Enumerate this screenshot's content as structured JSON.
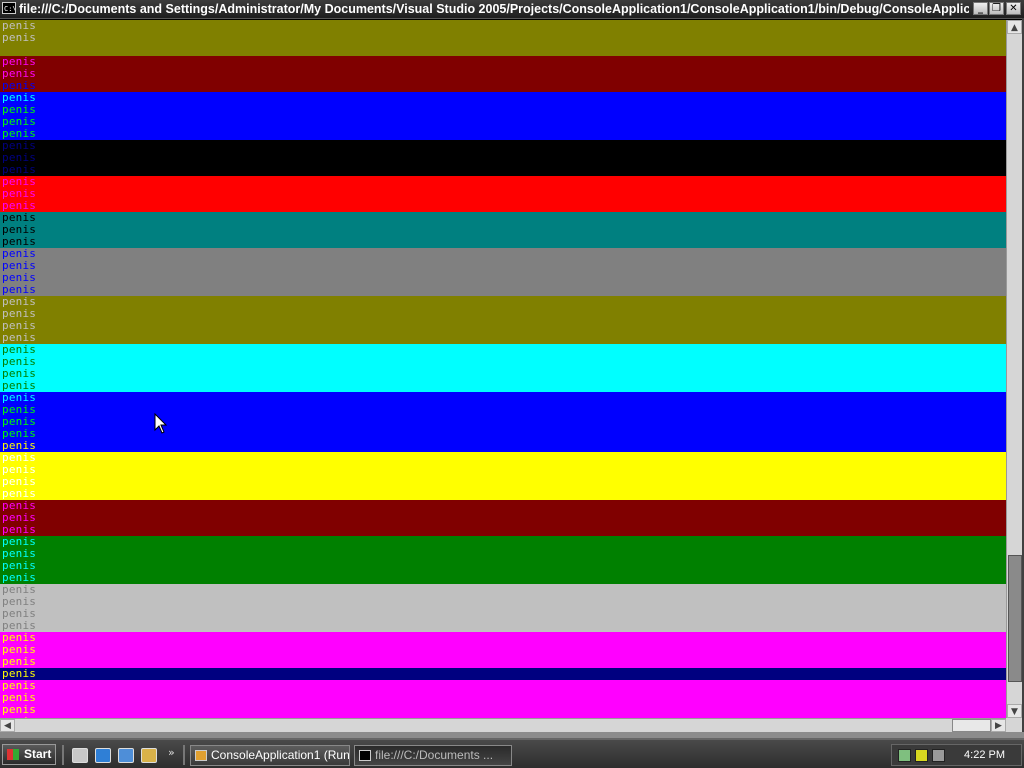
{
  "window": {
    "icon_text": "C:\\",
    "title": "file:///C:/Documents and Settings/Administrator/My Documents/Visual Studio 2005/Projects/ConsoleApplication1/ConsoleApplication1/bin/Debug/ConsoleApplicatio...",
    "minimize": "_",
    "restore": "❐",
    "close": "✕"
  },
  "console": {
    "word": "penis",
    "lines": [
      {
        "bg": "#808000",
        "fg": "#c0c0c0",
        "text": "penis"
      },
      {
        "bg": "#808000",
        "fg": "#c0c0c0",
        "text": "penis"
      },
      {
        "bg": "#808000",
        "fg": "#c0c0c0",
        "text": ""
      },
      {
        "bg": "#800000",
        "fg": "#ff00ff",
        "text": "penis"
      },
      {
        "bg": "#800000",
        "fg": "#ff00ff",
        "text": "penis"
      },
      {
        "bg": "#800000",
        "fg": "#0000ff",
        "text": "penis"
      },
      {
        "bg": "#0000ff",
        "fg": "#00ffff",
        "text": "penis"
      },
      {
        "bg": "#0000ff",
        "fg": "#00ff00",
        "text": "penis"
      },
      {
        "bg": "#0000ff",
        "fg": "#00ff00",
        "text": "penis"
      },
      {
        "bg": "#0000ff",
        "fg": "#00ff00",
        "text": "penis"
      },
      {
        "bg": "#000000",
        "fg": "#000080",
        "text": "penis"
      },
      {
        "bg": "#000000",
        "fg": "#000080",
        "text": "penis"
      },
      {
        "bg": "#000000",
        "fg": "#000080",
        "text": "penis"
      },
      {
        "bg": "#ff0000",
        "fg": "#ff00ff",
        "text": "penis"
      },
      {
        "bg": "#ff0000",
        "fg": "#ff00ff",
        "text": "penis"
      },
      {
        "bg": "#ff0000",
        "fg": "#ff00ff",
        "text": "penis"
      },
      {
        "bg": "#008080",
        "fg": "#000000",
        "text": "penis"
      },
      {
        "bg": "#008080",
        "fg": "#000000",
        "text": "penis"
      },
      {
        "bg": "#008080",
        "fg": "#000000",
        "text": "penis"
      },
      {
        "bg": "#808080",
        "fg": "#0000ff",
        "text": "penis"
      },
      {
        "bg": "#808080",
        "fg": "#0000ff",
        "text": "penis"
      },
      {
        "bg": "#808080",
        "fg": "#0000ff",
        "text": "penis"
      },
      {
        "bg": "#808080",
        "fg": "#0000ff",
        "text": "penis"
      },
      {
        "bg": "#808000",
        "fg": "#c0c0c0",
        "text": "penis"
      },
      {
        "bg": "#808000",
        "fg": "#c0c0c0",
        "text": "penis"
      },
      {
        "bg": "#808000",
        "fg": "#c0c0c0",
        "text": "penis"
      },
      {
        "bg": "#808000",
        "fg": "#c0c0c0",
        "text": "penis"
      },
      {
        "bg": "#00ffff",
        "fg": "#008000",
        "text": "penis"
      },
      {
        "bg": "#00ffff",
        "fg": "#008000",
        "text": "penis"
      },
      {
        "bg": "#00ffff",
        "fg": "#008000",
        "text": "penis"
      },
      {
        "bg": "#00ffff",
        "fg": "#008000",
        "text": "penis"
      },
      {
        "bg": "#0000ff",
        "fg": "#00ffff",
        "text": "penis"
      },
      {
        "bg": "#0000ff",
        "fg": "#00ff00",
        "text": "penis"
      },
      {
        "bg": "#0000ff",
        "fg": "#00ff00",
        "text": "penis"
      },
      {
        "bg": "#0000ff",
        "fg": "#00ff00",
        "text": "penis"
      },
      {
        "bg": "#0000ff",
        "fg": "#ffff00",
        "text": "penis"
      },
      {
        "bg": "#ffff00",
        "fg": "#ffffff",
        "text": "penis"
      },
      {
        "bg": "#ffff00",
        "fg": "#ffffff",
        "text": "penis"
      },
      {
        "bg": "#ffff00",
        "fg": "#ffffff",
        "text": "penis"
      },
      {
        "bg": "#ffff00",
        "fg": "#ffffff",
        "text": "penis"
      },
      {
        "bg": "#800000",
        "fg": "#ff00ff",
        "text": "penis"
      },
      {
        "bg": "#800000",
        "fg": "#ff00ff",
        "text": "penis"
      },
      {
        "bg": "#800000",
        "fg": "#ff00ff",
        "text": "penis"
      },
      {
        "bg": "#008000",
        "fg": "#00ffff",
        "text": "penis"
      },
      {
        "bg": "#008000",
        "fg": "#00ffff",
        "text": "penis"
      },
      {
        "bg": "#008000",
        "fg": "#00ffff",
        "text": "penis"
      },
      {
        "bg": "#008000",
        "fg": "#00ffff",
        "text": "penis"
      },
      {
        "bg": "#c0c0c0",
        "fg": "#808080",
        "text": "penis"
      },
      {
        "bg": "#c0c0c0",
        "fg": "#808080",
        "text": "penis"
      },
      {
        "bg": "#c0c0c0",
        "fg": "#808080",
        "text": "penis"
      },
      {
        "bg": "#c0c0c0",
        "fg": "#808080",
        "text": "penis"
      },
      {
        "bg": "#ff00ff",
        "fg": "#ffff00",
        "text": "penis"
      },
      {
        "bg": "#ff00ff",
        "fg": "#ffff00",
        "text": "penis"
      },
      {
        "bg": "#ff00ff",
        "fg": "#ffff00",
        "text": "penis"
      },
      {
        "bg": "#000080",
        "fg": "#ffff00",
        "text": "penis"
      },
      {
        "bg": "#ff00ff",
        "fg": "#ffff00",
        "text": "penis"
      },
      {
        "bg": "#ff00ff",
        "fg": "#ffff00",
        "text": "penis"
      },
      {
        "bg": "#ff00ff",
        "fg": "#ffff00",
        "text": "penis"
      },
      {
        "bg": "#ff00ff",
        "fg": "#ffff00",
        "text": "penis"
      }
    ]
  },
  "scrollbars": {
    "vertical_position": 0.96,
    "vertical_visible_fraction": 0.19,
    "horizontal_position": 1.0,
    "horizontal_visible_fraction": 0.04
  },
  "taskbar": {
    "start_label": "Start",
    "quick_launch": [
      {
        "name": "show-desktop-icon",
        "color": "#c8c8c8"
      },
      {
        "name": "internet-explorer-icon",
        "color": "#2f7fd6"
      },
      {
        "name": "outlook-express-icon",
        "color": "#4e8ed8"
      },
      {
        "name": "windows-media-icon",
        "color": "#d9b24a"
      }
    ],
    "more_label": "»",
    "tasks": [
      {
        "label": "ConsoleApplication1 (Run...",
        "icon": "visual-studio-icon",
        "icon_color": "#e0a030"
      },
      {
        "label": "file:///C:/Documents ...",
        "icon": "console-icon",
        "icon_color": "#000000"
      }
    ],
    "tray_icons": [
      {
        "name": "network-icon",
        "color": "#7fbf7f"
      },
      {
        "name": "antivirus-icon",
        "color": "#d8d820"
      },
      {
        "name": "sound-icon",
        "color": "#9a9a9a"
      }
    ],
    "clock": "4:22 PM"
  }
}
